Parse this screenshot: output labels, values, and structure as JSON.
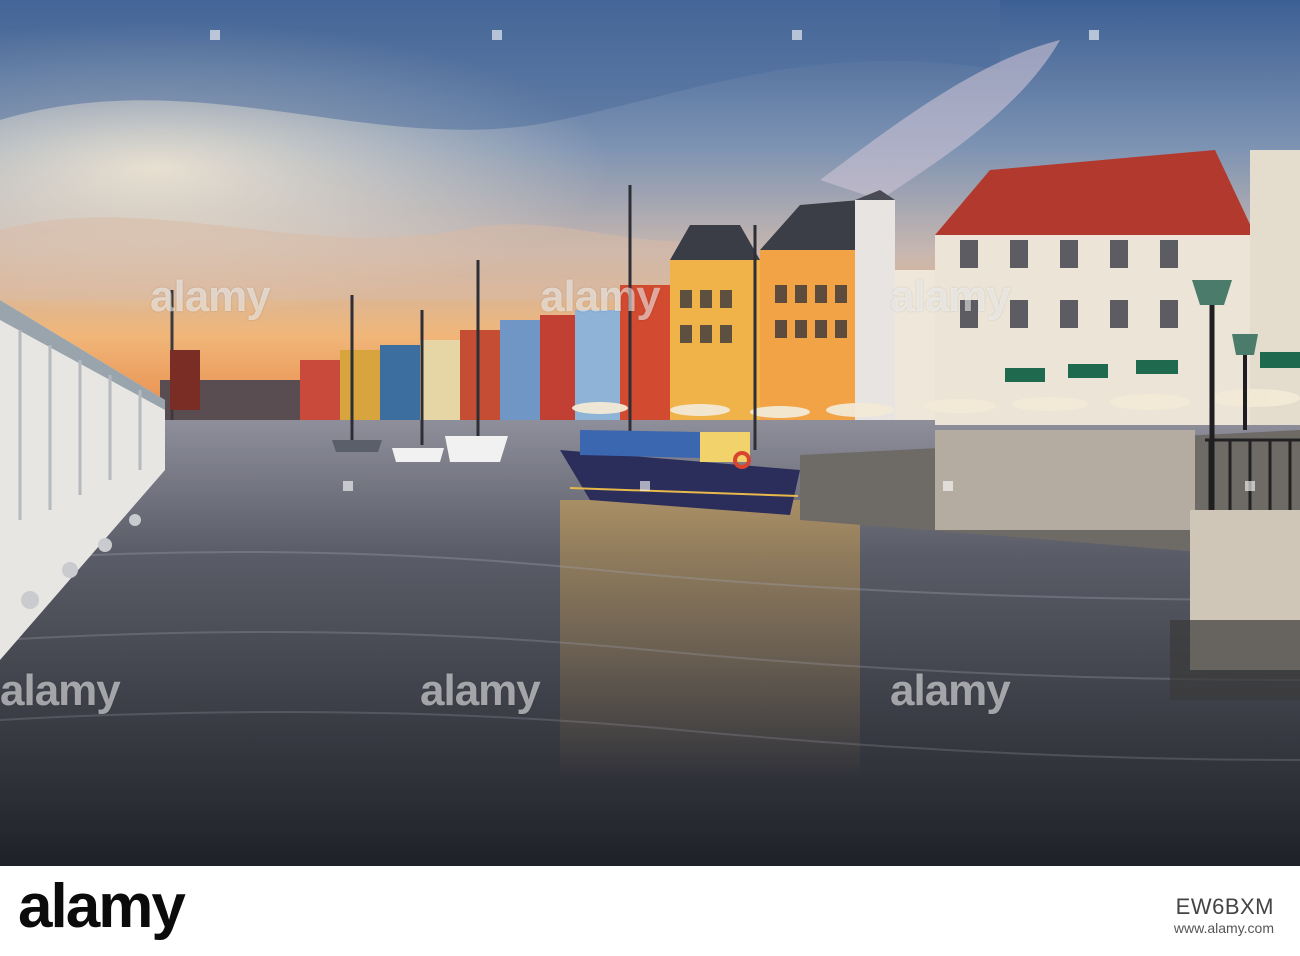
{
  "image": {
    "description_colors": {
      "sky_top": "#3a5a8c",
      "sky_mid": "#6f86a8",
      "sunset": "#f1a35a",
      "water": "#3c3f4a",
      "white_building": "#e9e4da",
      "yellow_building": "#f0b34a",
      "boat_hull": "#2b2e5a",
      "awning_green": "#1f6a4e"
    },
    "watermark_text": "alamy"
  },
  "footer": {
    "logo": "alamy",
    "stock_id": "EW6BXM",
    "website": "www.alamy.com"
  }
}
